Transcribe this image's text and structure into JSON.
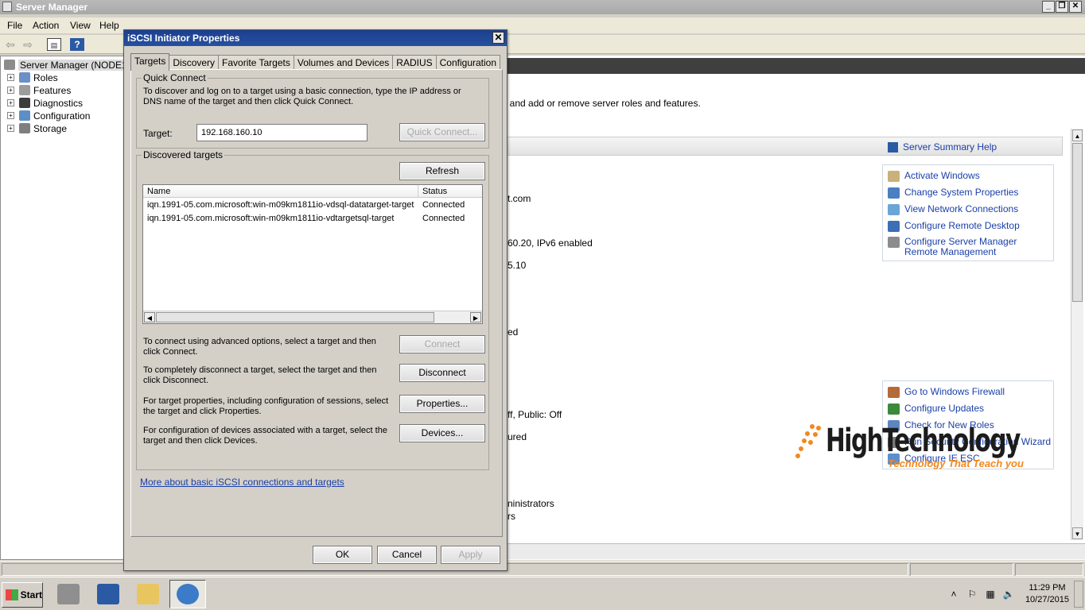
{
  "window": {
    "title": "Server Manager",
    "minimize": "_",
    "restore": "❐",
    "close": "✕"
  },
  "menu": [
    "File",
    "Action",
    "View",
    "Help"
  ],
  "tree": {
    "root": "Server Manager (NODE1)",
    "items": [
      "Roles",
      "Features",
      "Diagnostics",
      "Configuration",
      "Storage"
    ]
  },
  "content": {
    "intro_fragment": "s, and add or remove server roles and features.",
    "fragments": [
      "t.com",
      "60.20, IPv6 enabled",
      "5.10",
      "ed",
      "ff, Public: Off",
      "ured",
      "ninistrators",
      "rs"
    ],
    "summary_help": "Server Summary Help",
    "computer_links": [
      "Activate Windows",
      "Change System Properties",
      "View Network Connections",
      "Configure Remote Desktop",
      "Configure Server Manager Remote Management"
    ],
    "security_links": [
      "Go to Windows Firewall",
      "Configure Updates",
      "Check for New Roles",
      "Run Security Configuration Wizard",
      "Configure IE ESC"
    ]
  },
  "dialog": {
    "title": "iSCSI Initiator Properties",
    "close": "✕",
    "tabs": [
      "Targets",
      "Discovery",
      "Favorite Targets",
      "Volumes and Devices",
      "RADIUS",
      "Configuration"
    ],
    "active_tab": "Targets",
    "quick_connect": {
      "label": "Quick Connect",
      "description": "To discover and log on to a target using a basic connection, type the IP address or DNS name of the target and then click Quick Connect.",
      "target_label": "Target:",
      "target_value": "192.168.160.10",
      "button": "Quick Connect..."
    },
    "discovered": {
      "label": "Discovered targets",
      "refresh": "Refresh",
      "columns": [
        "Name",
        "Status"
      ],
      "rows": [
        {
          "name": "iqn.1991-05.com.microsoft:win-m09km1811io-vdsql-datatarget-target",
          "status": "Connected"
        },
        {
          "name": "iqn.1991-05.com.microsoft:win-m09km1811io-vdtargetsql-target",
          "status": "Connected"
        }
      ],
      "actions": [
        {
          "text": "To connect using advanced options, select a target and then click Connect.",
          "button": "Connect",
          "disabled": true
        },
        {
          "text": "To completely disconnect a target, select the target and then click Disconnect.",
          "button": "Disconnect",
          "disabled": false
        },
        {
          "text": "For target properties, including configuration of sessions, select the target and click Properties.",
          "button": "Properties...",
          "disabled": false
        },
        {
          "text": "For configuration of devices associated with a target, select the target and then click Devices.",
          "button": "Devices...",
          "disabled": false
        }
      ]
    },
    "more_link": "More about basic iSCSI connections and targets",
    "ok": "OK",
    "cancel": "Cancel",
    "apply": "Apply"
  },
  "taskbar": {
    "start": "Start",
    "clock_time": "11:29 PM",
    "clock_date": "10/27/2015"
  },
  "watermark": {
    "brand": "HighTechnology",
    "tagline": "Technology That Teach you"
  },
  "colors": {
    "link": "#1a3fa8",
    "dialog_title": "#1c3f8f",
    "watermark_accent": "#f0891f"
  }
}
